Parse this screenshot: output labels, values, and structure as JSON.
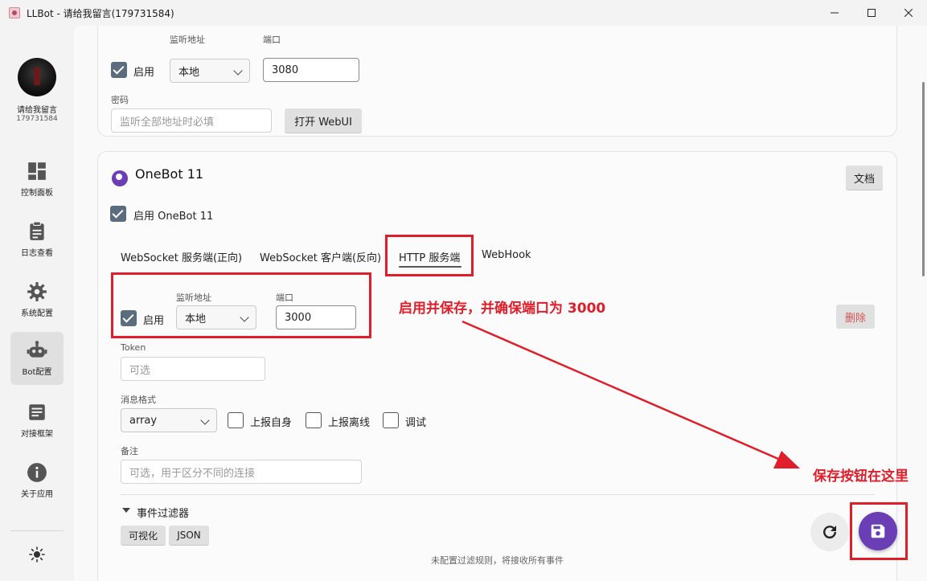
{
  "window": {
    "title": "LLBot - 请给我留言(179731584)"
  },
  "user": {
    "name": "请给我留言",
    "id": "179731584"
  },
  "sidebar": {
    "items": [
      {
        "label": "控制面板",
        "icon": "dashboard-icon"
      },
      {
        "label": "日志查看",
        "icon": "clipboard-icon"
      },
      {
        "label": "系统配置",
        "icon": "gear-icon"
      },
      {
        "label": "Bot配置",
        "icon": "robot-icon",
        "active": true
      },
      {
        "label": "对接框架",
        "icon": "document-icon"
      },
      {
        "label": "关于应用",
        "icon": "info-icon"
      }
    ],
    "theme_icon": "sun-icon"
  },
  "webui_card": {
    "enable_label": "启用",
    "enable_checked": true,
    "listen_label": "监听地址",
    "listen_value": "本地",
    "port_label": "端口",
    "port_value": "3080",
    "password_label": "密码",
    "password_placeholder": "监听全部地址时必填",
    "open_webui_label": "打开 WebUI"
  },
  "onebot_card": {
    "title": "OneBot 11",
    "docs_label": "文档",
    "enable_label": "启用 OneBot 11",
    "enable_checked": true,
    "tabs": [
      {
        "label": "WebSocket 服务端(正向)"
      },
      {
        "label": "WebSocket 客户端(反向)"
      },
      {
        "label": "HTTP 服务端",
        "active": true
      },
      {
        "label": "WebHook"
      }
    ],
    "http": {
      "enable_label": "启用",
      "enable_checked": true,
      "listen_label": "监听地址",
      "listen_value": "本地",
      "port_label": "端口",
      "port_value": "3000",
      "delete_label": "删除",
      "token_label": "Token",
      "token_placeholder": "可选",
      "msg_format_label": "消息格式",
      "msg_format_value": "array",
      "report_self_label": "上报自身",
      "report_offline_label": "上报离线",
      "debug_label": "调试",
      "note_label": "备注",
      "note_placeholder": "可选，用于区分不同的连接"
    },
    "filter": {
      "title": "事件过滤器",
      "visual_label": "可视化",
      "json_label": "JSON",
      "hint": "未配置过滤规则，将接收所有事件"
    }
  },
  "annotations": {
    "step_text": "启用并保存，并确保端口为 3000",
    "save_text": "保存按钮在这里",
    "color": "#e01e2a"
  },
  "colors": {
    "accent": "#6a3fb5",
    "checkbox": "#5a6c7d",
    "danger": "#d9534f"
  }
}
